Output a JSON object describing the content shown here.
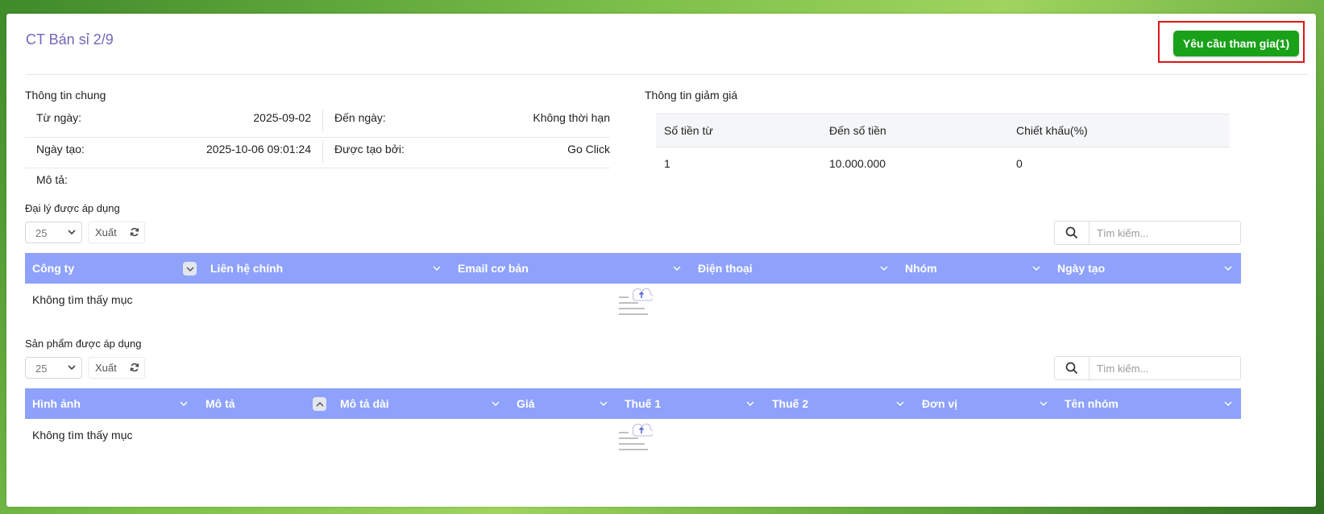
{
  "page": {
    "title": "CT Bán sỉ 2/9",
    "join_button": "Yêu cầu tham gia(1)",
    "accent_color": "#8ea2fb",
    "button_color": "#1aa11a",
    "title_color": "#7566b8"
  },
  "general": {
    "title": "Thông tin chung",
    "from_label": "Từ ngày:",
    "from_value": "2025-09-02",
    "to_label": "Đến ngày:",
    "to_value": "Không thời hạn",
    "created_label": "Ngày tạo:",
    "created_value": "2025-10-06 09:01:24",
    "created_by_label": "Được tạo bởi:",
    "created_by_value": "Go Click",
    "desc_label": "Mô tả:"
  },
  "discount": {
    "title": "Thông tin giảm giá",
    "headers": [
      "Số tiền từ",
      "Đến số tiền",
      "Chiết khấu(%)"
    ],
    "rows": [
      [
        "1",
        "10.000.000",
        "0"
      ]
    ]
  },
  "agents": {
    "title": "Đại lý được áp dụng",
    "page_size": "25",
    "export_label": "Xuất",
    "search_placeholder": "Tìm kiếm...",
    "columns": [
      "Công ty",
      "Liên hệ chính",
      "Email cơ bản",
      "Điện thoại",
      "Nhóm",
      "Ngày tạo"
    ],
    "empty_text": "Không tìm thấy mục"
  },
  "products": {
    "title": "Sản phẩm được áp dụng",
    "page_size": "25",
    "export_label": "Xuất",
    "search_placeholder": "Tìm kiếm...",
    "columns": [
      "Hình ảnh",
      "Mô tả",
      "Mô tả dài",
      "Giá",
      "Thuế 1",
      "Thuế 2",
      "Đơn vị",
      "Tên nhóm"
    ],
    "empty_text": "Không tìm thấy mục"
  }
}
